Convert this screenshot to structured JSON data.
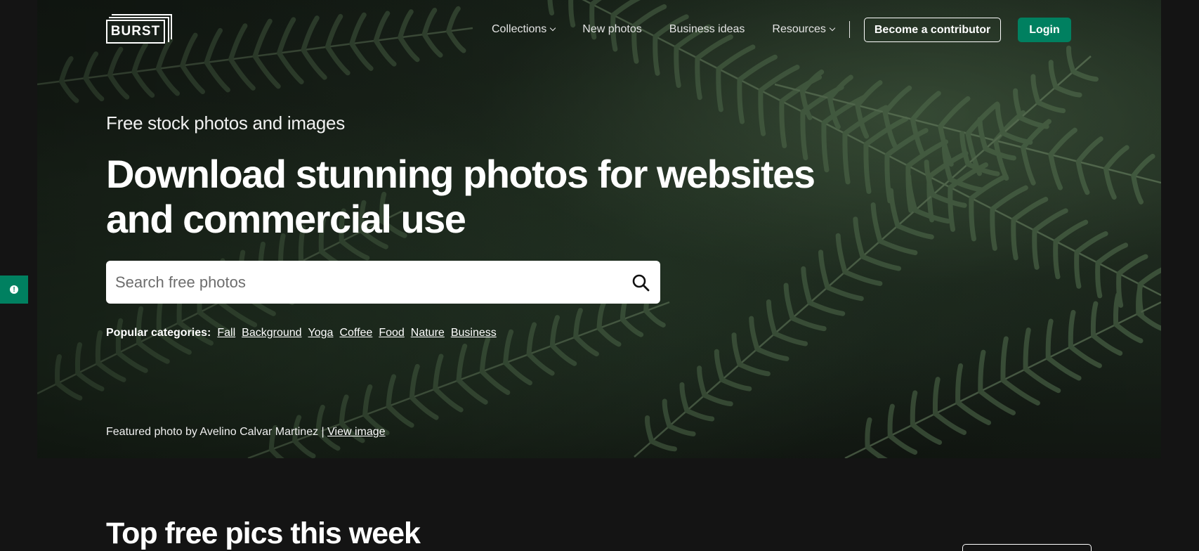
{
  "brand": {
    "logo_text": "BURST"
  },
  "nav": {
    "items": [
      {
        "label": "Collections",
        "dropdown": true
      },
      {
        "label": "New photos",
        "dropdown": false
      },
      {
        "label": "Business ideas",
        "dropdown": false
      },
      {
        "label": "Resources",
        "dropdown": true
      }
    ],
    "contributor_label": "Become a contributor",
    "login_label": "Login"
  },
  "hero": {
    "eyebrow": "Free stock photos and images",
    "headline": "Download stunning photos for websites and commercial use",
    "search": {
      "placeholder": "Search free photos",
      "icon": "search-icon"
    },
    "popular": {
      "label": "Popular categories:",
      "categories": [
        "Fall",
        "Background",
        "Yoga",
        "Coffee",
        "Food",
        "Nature",
        "Business"
      ]
    },
    "credit": {
      "text": "Featured photo by Avelino Calvar Martinez |",
      "link": "View image"
    }
  },
  "side_tab": {
    "icon": "info-icon"
  },
  "section": {
    "title": "Top free pics this week"
  },
  "colors": {
    "accent": "#008060",
    "background": "#141414",
    "text": "#ffffff"
  }
}
